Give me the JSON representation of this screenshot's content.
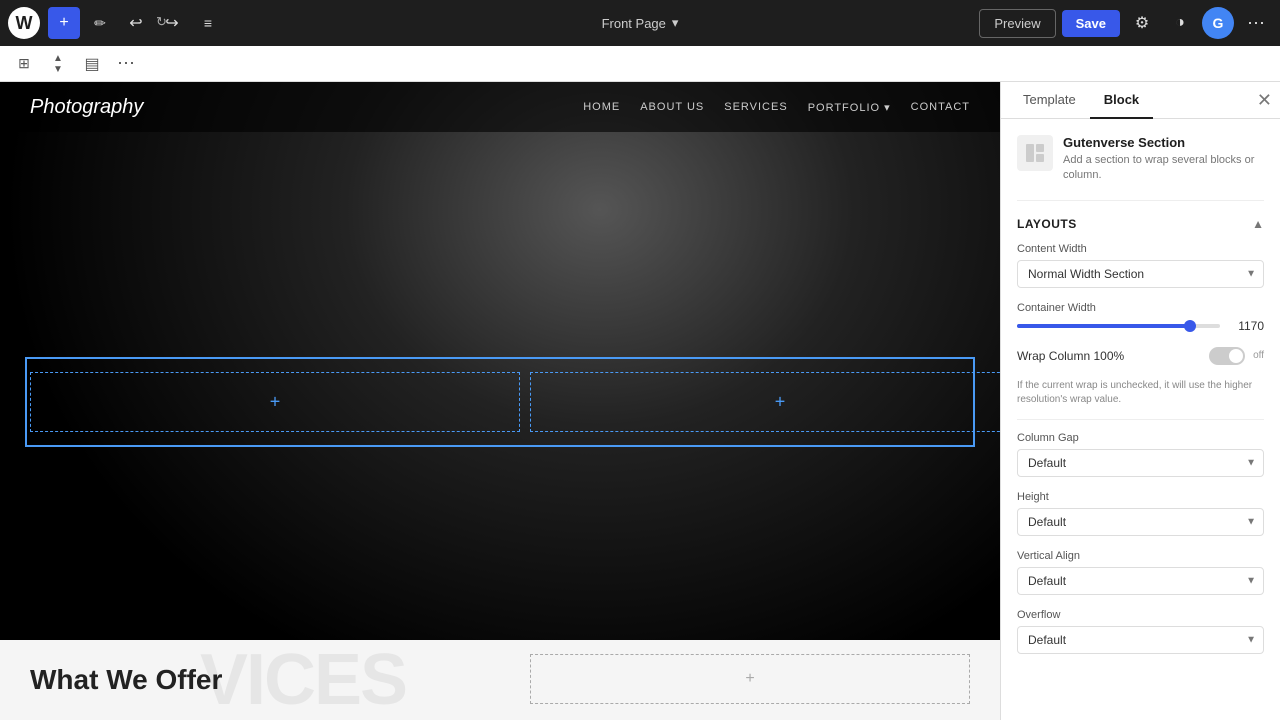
{
  "topBar": {
    "logoText": "W",
    "addLabel": "+",
    "undoLabel": "↩",
    "redoLabel": "↪",
    "listLabel": "≡",
    "pageName": "Front Page",
    "dropdownArrow": "▾",
    "previewLabel": "Preview",
    "saveLabel": "Save",
    "settingsLabel": "⚙",
    "themeLabel": "◑",
    "googleLabel": "G"
  },
  "secondBar": {
    "layoutIcon": "⊞",
    "arrowIcon": "▲▼",
    "alignIcon": "≡",
    "dotsIcon": "⋯"
  },
  "siteNav": {
    "logo": "Photography",
    "links": [
      "HOME",
      "ABOUT US",
      "SERVICES",
      "PORTFOLIO ▾",
      "CONTACT"
    ]
  },
  "bottomSection": {
    "heading": "What We Offer",
    "backgroundText": "VICES"
  },
  "rightPanel": {
    "tabs": [
      "Template",
      "Block"
    ],
    "activeTab": "Block",
    "blockInfo": {
      "title": "Gutenverse Section",
      "description": "Add a section to wrap several blocks or column."
    },
    "sections": {
      "layouts": {
        "title": "Layouts",
        "contentWidth": {
          "label": "Content Width",
          "value": "Normal Width Section"
        },
        "containerWidth": {
          "label": "Container Width",
          "value": "1170",
          "sliderPercent": 85
        },
        "wrapColumn": {
          "label": "Wrap Column 100%",
          "state": "off"
        },
        "wrapHelp": "If the current wrap is unchecked, it will use the higher resolution's wrap value.",
        "columnGap": {
          "label": "Column Gap",
          "value": "Default"
        },
        "height": {
          "label": "Height",
          "value": "Default"
        },
        "verticalAlign": {
          "label": "Vertical Align",
          "value": "Default"
        },
        "overflow": {
          "label": "Overflow",
          "value": "Default"
        }
      }
    }
  }
}
